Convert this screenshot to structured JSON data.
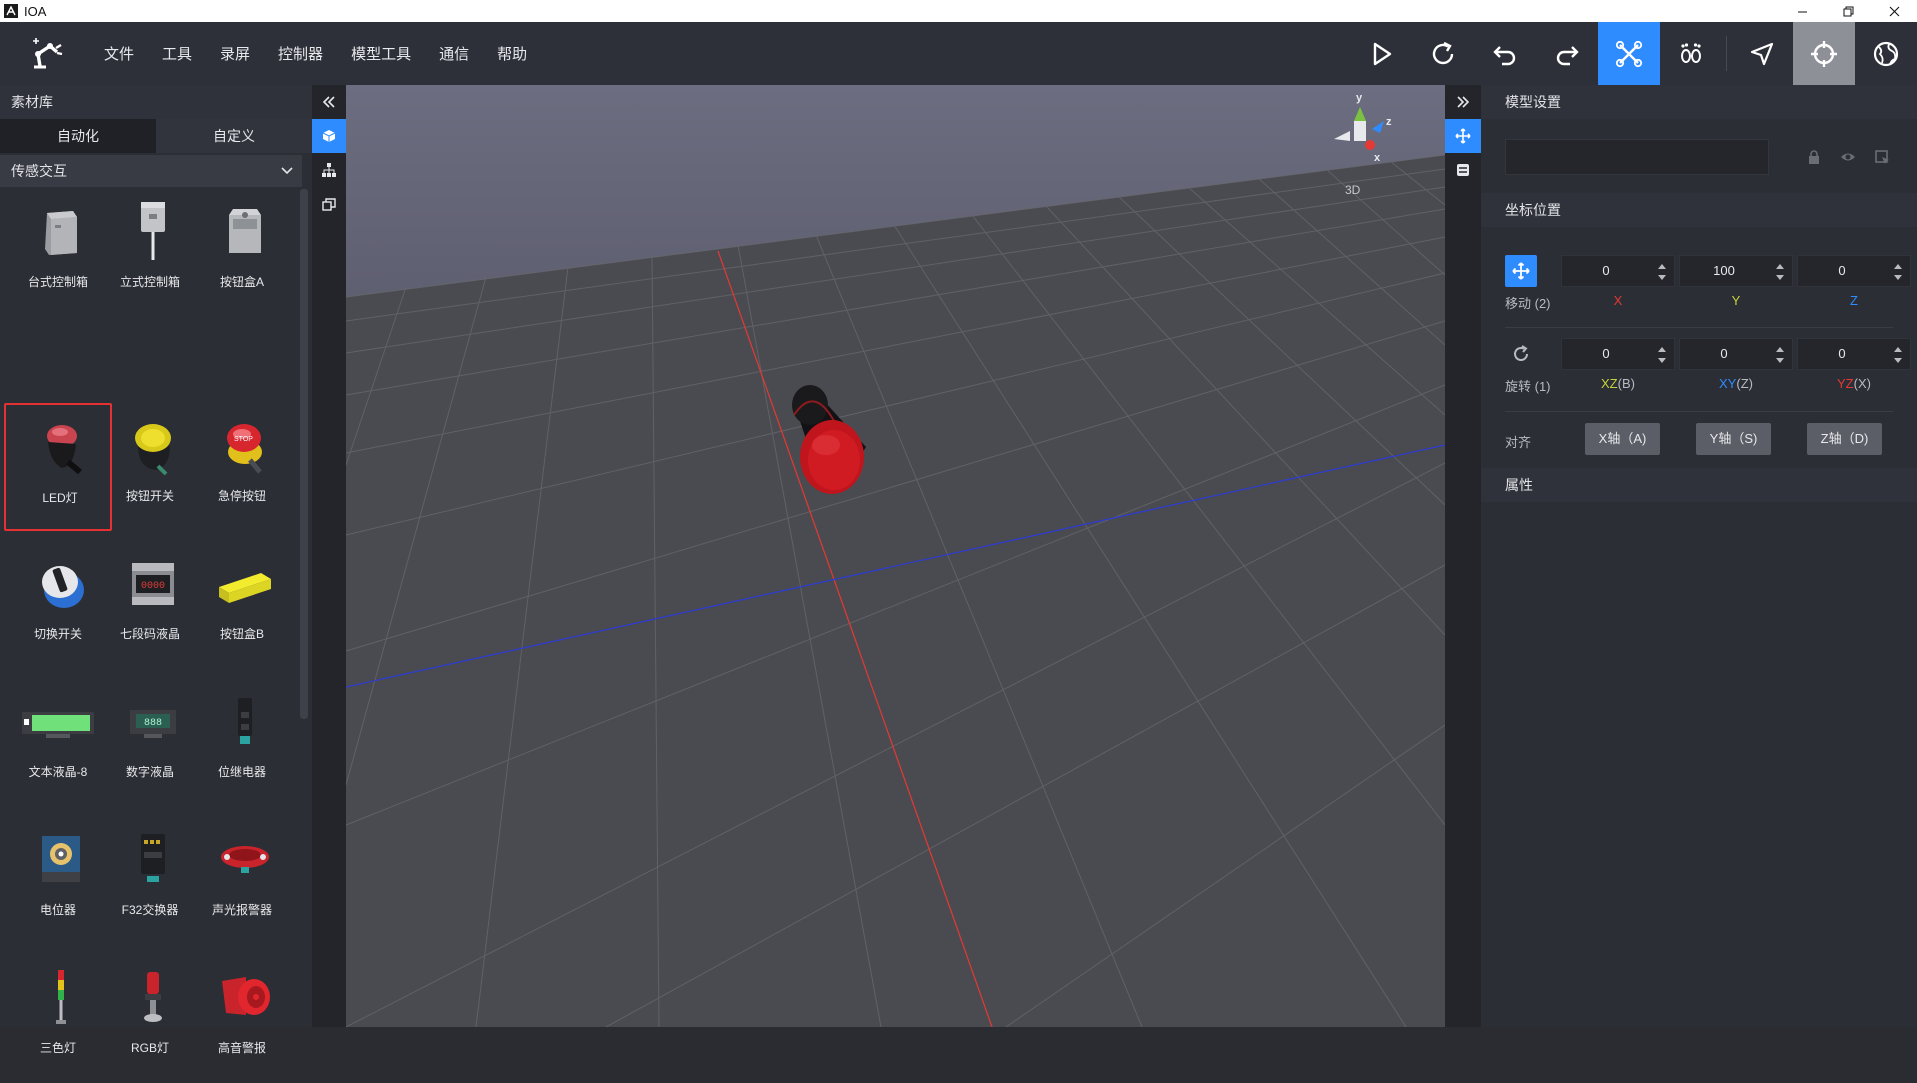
{
  "window": {
    "title": "IOA"
  },
  "menu": [
    "文件",
    "工具",
    "录屏",
    "控制器",
    "模型工具",
    "通信",
    "帮助"
  ],
  "toolbar": {
    "icons": [
      "play-icon",
      "refresh-icon",
      "undo-icon",
      "redo-icon",
      "drone-icon",
      "footprints-icon",
      "pointer-icon",
      "crosshair-icon",
      "globe-icon"
    ]
  },
  "library": {
    "title": "素材库",
    "tabs": [
      "自动化",
      "自定义"
    ],
    "category": "传感交互",
    "items": [
      "台式控制箱",
      "立式控制箱",
      "按钮盒A",
      "LED灯",
      "按钮开关",
      "急停按钮",
      "切换开关",
      "七段码液晶",
      "按钮盒B",
      "文本液晶-8",
      "数字液晶",
      "位继电器",
      "电位器",
      "F32交换器",
      "声光报警器",
      "三色灯",
      "RGB灯",
      "高音警报"
    ],
    "selected": "LED灯",
    "display_7seg": "0000",
    "display_digital": "888"
  },
  "viewport": {
    "mode_label": "3D",
    "gizmo_axes": [
      "y",
      "z",
      "x"
    ]
  },
  "model_settings": {
    "title": "模型设置",
    "name_value": ""
  },
  "coords": {
    "title": "坐标位置",
    "move_label": "移动 (2)",
    "move": {
      "x": "0",
      "y": "100",
      "z": "0"
    },
    "move_axes": [
      "X",
      "Y",
      "Z"
    ],
    "rotate_label": "旋转 (1)",
    "rotate": {
      "xz": "0",
      "xy": "0",
      "yz": "0"
    },
    "rotate_axes": [
      {
        "a": "XZ",
        "b": "(B)"
      },
      {
        "a": "XY",
        "b": "(Z)"
      },
      {
        "a": "YZ",
        "b": "(X)"
      }
    ],
    "align_label": "对齐",
    "align_buttons": [
      "X轴（A)",
      "Y轴（S)",
      "Z轴（D)"
    ]
  },
  "properties": {
    "title": "属性"
  },
  "colors": {
    "accent": "#2f8cff",
    "axis_x": "#e53935",
    "axis_y": "#c6d23a",
    "axis_z": "#2f8cff",
    "selected_border": "#e53131"
  }
}
